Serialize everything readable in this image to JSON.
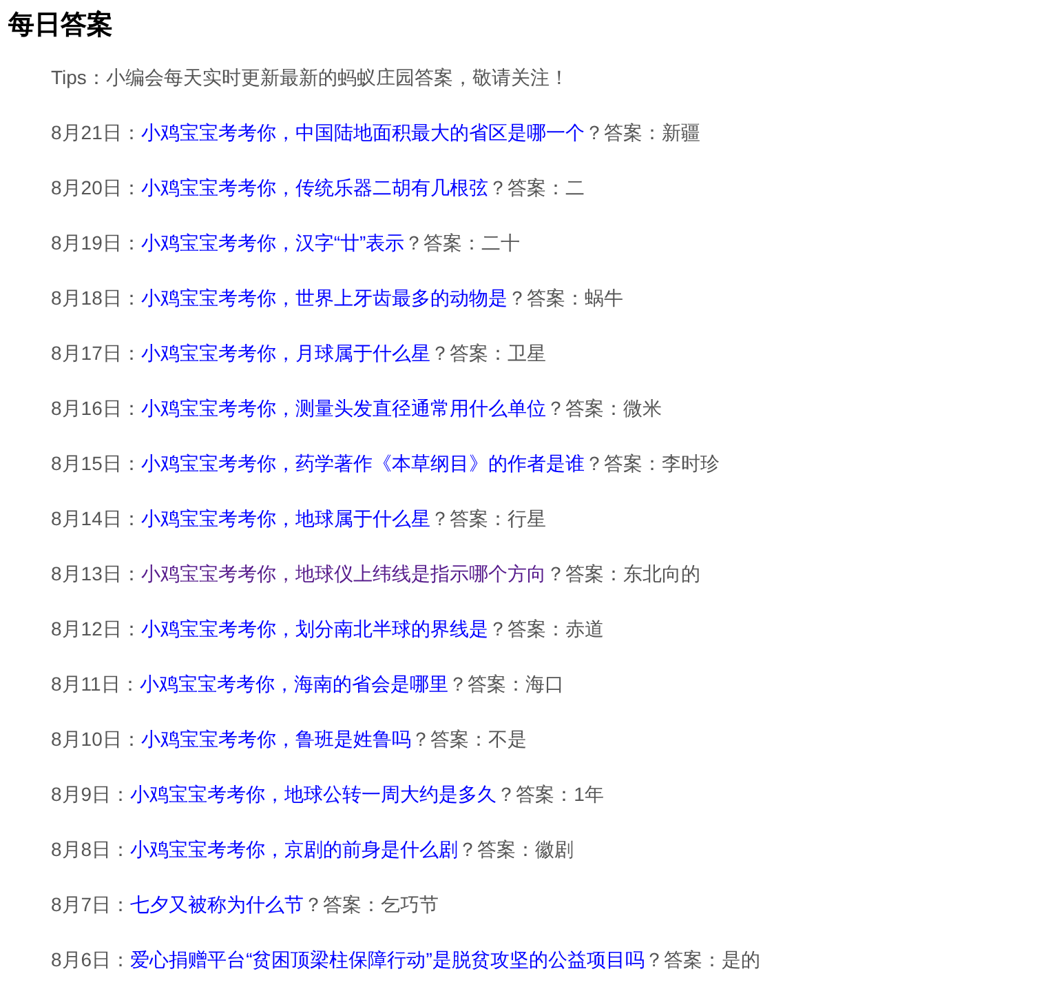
{
  "title": "每日答案",
  "tips": "Tips：小编会每天实时更新最新的蚂蚁庄园答案，敬请关注！",
  "entries": [
    {
      "date": "8月21日：",
      "question": "小鸡宝宝考考你，中国陆地面积最大的省区是哪一个",
      "answer": "？答案：新疆",
      "visited": false
    },
    {
      "date": "8月20日：",
      "question": "小鸡宝宝考考你，传统乐器二胡有几根弦",
      "answer": "？答案：二",
      "visited": false
    },
    {
      "date": "8月19日：",
      "question": "小鸡宝宝考考你，汉字“廿”表示",
      "answer": "？答案：二十",
      "visited": false
    },
    {
      "date": "8月18日：",
      "question": "小鸡宝宝考考你，世界上牙齿最多的动物是",
      "answer": "？答案：蜗牛",
      "visited": false
    },
    {
      "date": "8月17日：",
      "question": "小鸡宝宝考考你，月球属于什么星",
      "answer": "？答案：卫星",
      "visited": false
    },
    {
      "date": "8月16日：",
      "question": "小鸡宝宝考考你，测量头发直径通常用什么单位",
      "answer": "？答案：微米",
      "visited": false
    },
    {
      "date": "8月15日：",
      "question": "小鸡宝宝考考你，药学著作《本草纲目》的作者是谁",
      "answer": "？答案：李时珍",
      "visited": false
    },
    {
      "date": "8月14日：",
      "question": "小鸡宝宝考考你，地球属于什么星",
      "answer": "？答案：行星",
      "visited": false
    },
    {
      "date": "8月13日：",
      "question": "小鸡宝宝考考你，地球仪上纬线是指示哪个方向",
      "answer": "？答案：东北向的",
      "visited": true
    },
    {
      "date": "8月12日：",
      "question": "小鸡宝宝考考你，划分南北半球的界线是",
      "answer": "？答案：赤道",
      "visited": false
    },
    {
      "date": "8月11日：",
      "question": "小鸡宝宝考考你，海南的省会是哪里",
      "answer": "？答案：海口",
      "visited": false
    },
    {
      "date": "8月10日：",
      "question": "小鸡宝宝考考你，鲁班是姓鲁吗",
      "answer": "？答案：不是",
      "visited": false
    },
    {
      "date": "8月9日：",
      "question": "小鸡宝宝考考你，地球公转一周大约是多久",
      "answer": "？答案：1年",
      "visited": false
    },
    {
      "date": "8月8日：",
      "question": "小鸡宝宝考考你，京剧的前身是什么剧",
      "answer": "？答案：徽剧",
      "visited": false
    },
    {
      "date": "8月7日：",
      "question": "七夕又被称为什么节",
      "answer": "？答案：乞巧节",
      "visited": false
    },
    {
      "date": "8月6日：",
      "question": "爱心捐赠平台“贫困顶梁柱保障行动”是脱贫攻坚的公益项目吗",
      "answer": "？答案：是的",
      "visited": false
    }
  ]
}
